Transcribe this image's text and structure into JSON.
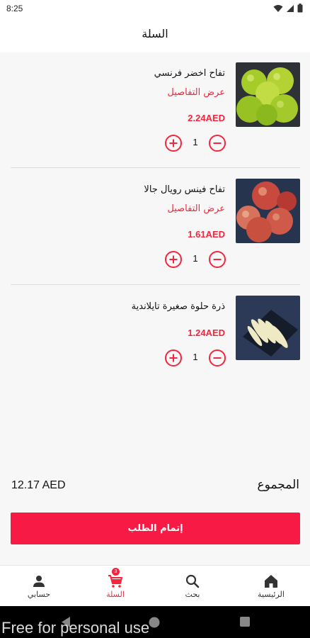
{
  "status_bar": {
    "time": "8:25"
  },
  "header": {
    "title": "السلة"
  },
  "items": [
    {
      "name": "تفاح اخضر فرنسي",
      "details_label": "عرض التفاصيل",
      "price": "2.24AED",
      "quantity": "1",
      "image": "green-apples"
    },
    {
      "name": "تفاح فينس رويال جالا",
      "details_label": "عرض التفاصيل",
      "price": "1.61AED",
      "quantity": "1",
      "image": "red-apples"
    },
    {
      "name": "ذرة حلوة صغيرة تايلاندية",
      "price": "1.24AED",
      "quantity": "1",
      "image": "baby-corn"
    }
  ],
  "summary": {
    "total_label": "المجموع",
    "total_value": "12.17 AED"
  },
  "checkout": {
    "label": "إتمام الطلب"
  },
  "bottom_nav": {
    "items": [
      {
        "label": "حسابي",
        "icon": "person-icon"
      },
      {
        "label": "السلة",
        "icon": "cart-icon",
        "badge": "3"
      },
      {
        "label": "بحث",
        "icon": "search-icon"
      },
      {
        "label": "الرئيسية",
        "icon": "home-icon"
      }
    ]
  },
  "watermark": "Free for personal use",
  "colors": {
    "accent": "#f4263d",
    "button": "#f71a44",
    "background": "#f7f7f7"
  }
}
